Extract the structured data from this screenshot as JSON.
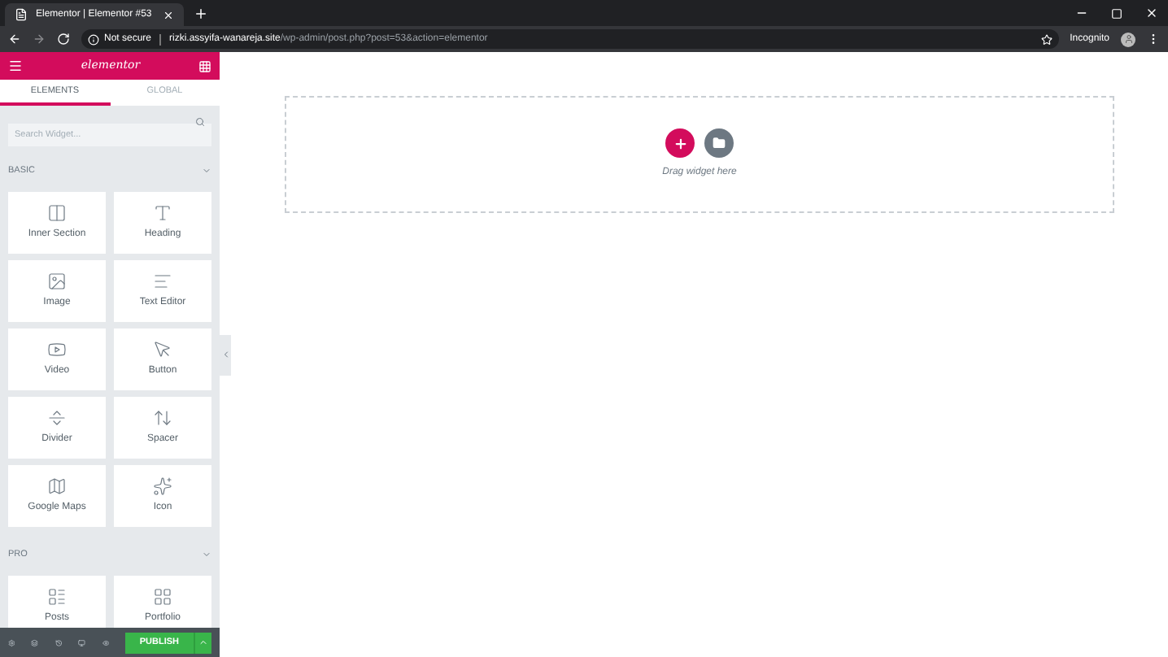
{
  "browser": {
    "tab_title": "Elementor | Elementor #53",
    "security": "Not secure",
    "url_host": "rizki.assyifa-wanareja.site",
    "url_path": "/wp-admin/post.php?post=53&action=elementor",
    "profile": "Incognito"
  },
  "panel": {
    "logo": "elementor",
    "tabs": [
      {
        "label": "ELEMENTS",
        "selected": true
      },
      {
        "label": "GLOBAL",
        "selected": false
      }
    ],
    "search": {
      "placeholder": "Search Widget..."
    },
    "sections": [
      {
        "title": "BASIC",
        "expanded": true,
        "widgets": [
          "Inner Section",
          "Heading",
          "Image",
          "Text Editor",
          "Video",
          "Button",
          "Divider",
          "Spacer",
          "Google Maps",
          "Icon"
        ]
      },
      {
        "title": "PRO",
        "expanded": true,
        "widgets": [
          "Posts",
          "Portfolio"
        ]
      }
    ],
    "publish": "PUBLISH"
  },
  "canvas": {
    "hint": "Drag widget here"
  }
}
